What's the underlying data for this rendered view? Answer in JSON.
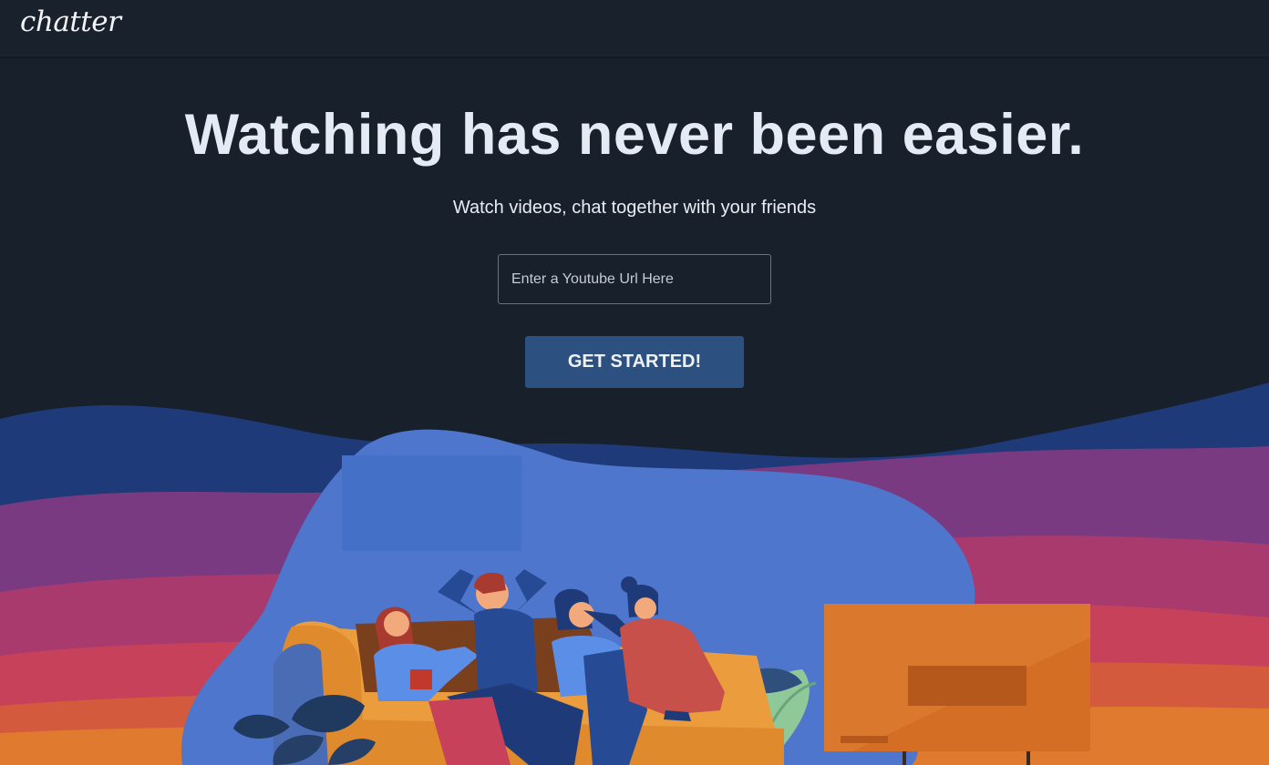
{
  "nav": {
    "logo": "chatter"
  },
  "hero": {
    "title": "Watching has never been easier.",
    "subtitle": "Watch videos, chat together with your friends"
  },
  "search": {
    "placeholder": "Enter a Youtube Url Here",
    "value": ""
  },
  "cta": {
    "label": "GET STARTED!"
  },
  "colors": {
    "background": "#18202c",
    "button": "#2c5180",
    "wave_blue": "#1f3a78",
    "wave_purple": "#7a3a82",
    "wave_pink": "#c0395e",
    "wave_orange": "#d65e35",
    "blob": "#4d76cc",
    "sofa": "#eb9c3c",
    "tv": "#d46e25"
  }
}
